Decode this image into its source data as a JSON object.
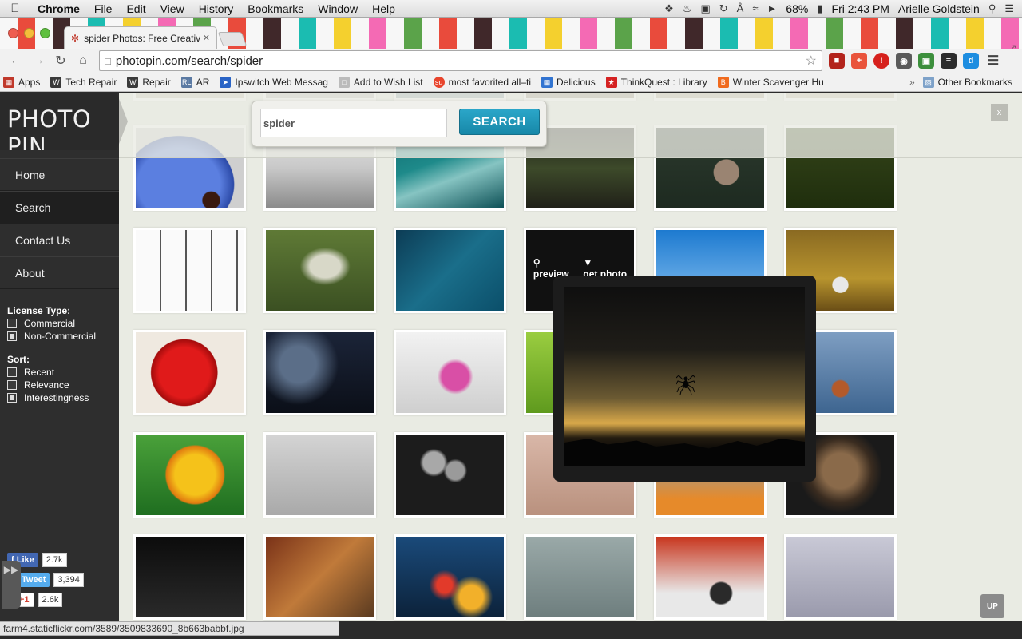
{
  "menubar": {
    "app": "Chrome",
    "items": [
      "File",
      "Edit",
      "View",
      "History",
      "Bookmarks",
      "Window",
      "Help"
    ],
    "battery": "68%",
    "clock": "Fri 2:43 PM",
    "user": "Arielle Goldstein"
  },
  "tab": {
    "title": "spider Photos: Free Creative"
  },
  "toolbar": {
    "url": "photopin.com/search/spider"
  },
  "bookmarks": [
    {
      "label": "Apps",
      "color": "#c0392b"
    },
    {
      "label": "Tech Repair",
      "color": "#3a3a3a"
    },
    {
      "label": "Repair",
      "color": "#3a3a3a"
    },
    {
      "label": "AR",
      "color": "#5b7aa3"
    },
    {
      "label": "Ipswitch Web Messag",
      "color": "#2a64c6"
    },
    {
      "label": "Add to Wish List",
      "color": "#bbbbbb"
    },
    {
      "label": "most favorited all–ti",
      "color": "#e8442c"
    },
    {
      "label": "Delicious",
      "color": "#3274d1"
    },
    {
      "label": "ThinkQuest : Library",
      "color": "#d52222"
    },
    {
      "label": "Winter Scavenger Hu",
      "color": "#f06a1d"
    }
  ],
  "bookmarks_other": "Other Bookmarks",
  "site": {
    "logo": "PHOTO PIN",
    "nav": [
      "Home",
      "Search",
      "Contact Us",
      "About"
    ],
    "license_heading": "License Type:",
    "license_options": [
      {
        "label": "Commercial",
        "checked": false
      },
      {
        "label": "Non-Commercial",
        "checked": true
      }
    ],
    "sort_heading": "Sort:",
    "sort_options": [
      {
        "label": "Recent",
        "checked": false
      },
      {
        "label": "Relevance",
        "checked": false
      },
      {
        "label": "Interestingness",
        "checked": true
      }
    ],
    "social": {
      "like_label": "Like",
      "like_count": "2.7k",
      "tweet_label": "Tweet",
      "tweet_count": "3,394",
      "plus_label": "+1",
      "plus_count": "2.6k"
    }
  },
  "search": {
    "value": "spider",
    "button": "SEARCH"
  },
  "close_label": "x",
  "hover_overlay": {
    "preview": "preview",
    "get": "get photo"
  },
  "up_label": "UP",
  "status_url": "farm4.staticflickr.com/3589/3509833690_8b663babbf.jpg",
  "colors": {
    "accent": "#1e95b8",
    "sidebar": "#2e2e2e",
    "page_bg": "#e9ebe3"
  }
}
